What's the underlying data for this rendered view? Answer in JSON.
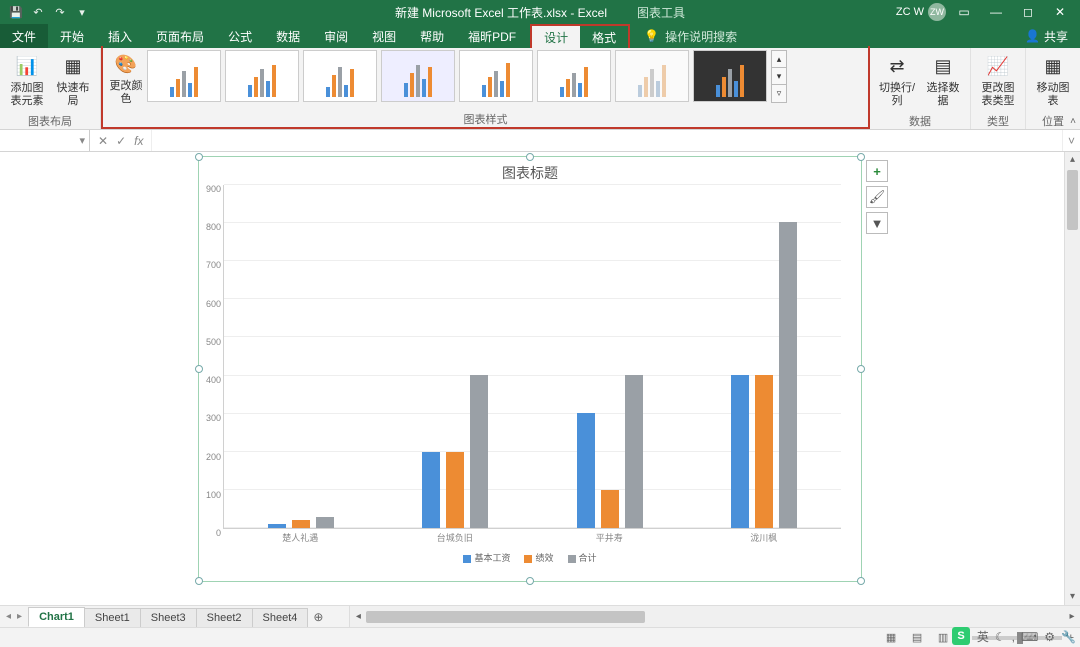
{
  "colors": {
    "series1": "#4a90d9",
    "series2": "#ed8b33",
    "series3": "#9aa0a6",
    "excel_green": "#217346",
    "highlight_red": "#c0392b"
  },
  "titlebar": {
    "doc_title": "新建 Microsoft Excel 工作表.xlsx  -  Excel",
    "contextual_title": "图表工具",
    "user_initials": "ZC W",
    "avatar_initials": "ZW"
  },
  "tabs": {
    "file": "文件",
    "list": [
      "开始",
      "插入",
      "页面布局",
      "公式",
      "数据",
      "审阅",
      "视图",
      "帮助",
      "福昕PDF"
    ],
    "contextual": [
      "设计",
      "格式"
    ],
    "active": "设计",
    "tellme": "操作说明搜索",
    "share": "共享"
  },
  "ribbon": {
    "layout_group": "图表布局",
    "add_element": "添加图表元素",
    "quick_layout": "快速布局",
    "change_colors": "更改颜色",
    "styles_group": "图表样式",
    "data_group": "数据",
    "switch_rc": "切换行/列",
    "select_data": "选择数据",
    "type_group": "类型",
    "change_type": "更改图表类型",
    "location_group": "位置",
    "move_chart": "移动图表"
  },
  "fx": {
    "namebox": "",
    "cancel": "✕",
    "enter": "✓",
    "fx": "fx"
  },
  "chart_data": {
    "type": "bar",
    "title": "图表标题",
    "categories": [
      "楚人礼遇",
      "台城负旧",
      "平井寿",
      "泷川枫"
    ],
    "series": [
      {
        "name": "基本工资",
        "values": [
          10,
          200,
          300,
          400
        ]
      },
      {
        "name": "绩效",
        "values": [
          20,
          200,
          100,
          400
        ]
      },
      {
        "name": "合计",
        "values": [
          30,
          400,
          400,
          800
        ]
      }
    ],
    "ylim": [
      0,
      900
    ],
    "y_ticks": [
      0,
      100,
      200,
      300,
      400,
      500,
      600,
      700,
      800,
      900
    ],
    "xlabel": "",
    "ylabel": ""
  },
  "chart_buttons": {
    "plus": "+",
    "brush": "brush-icon",
    "filter": "filter-icon"
  },
  "sheets": {
    "tabs": [
      "Chart1",
      "Sheet1",
      "Sheet3",
      "Sheet2",
      "Sheet4"
    ],
    "active": "Chart1"
  },
  "status": {
    "zoom_minus": "−",
    "zoom_plus": "+"
  },
  "ime": {
    "badge": "S",
    "lang": "英",
    "moon": "☾",
    "comma": ",",
    "kbd": "⌨",
    "gear": "⚙"
  }
}
